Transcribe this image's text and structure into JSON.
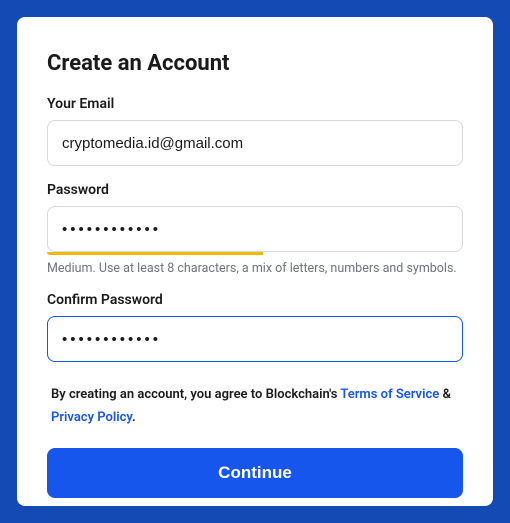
{
  "title": "Create an Account",
  "email": {
    "label": "Your Email",
    "value": "cryptomedia.id@gmail.com"
  },
  "password": {
    "label": "Password",
    "value": "••••••••••••",
    "strength_text": "Medium. Use at least 8 characters, a mix of letters, numbers and symbols."
  },
  "confirm": {
    "label": "Confirm Password",
    "value": "••••••••••••"
  },
  "agreement": {
    "prefix": "By creating an account, you agree to Blockchain's ",
    "terms_label": "Terms of Service",
    "connector": " & ",
    "privacy_label": "Privacy Policy",
    "suffix": "."
  },
  "continue_label": "Continue"
}
